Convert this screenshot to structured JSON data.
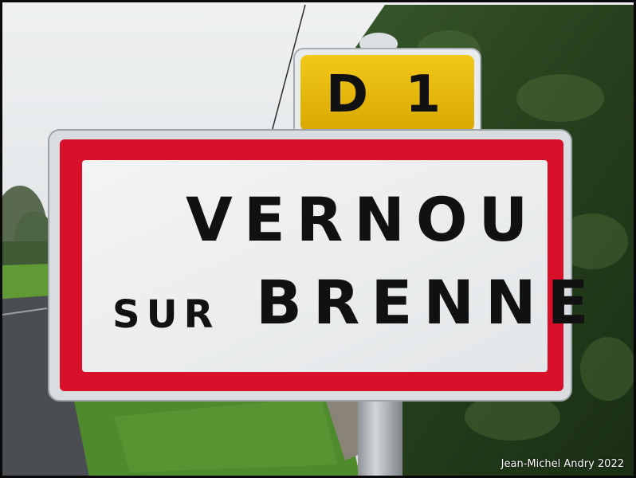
{
  "photo": {
    "subject": "road-sign",
    "colors": {
      "sky": "#e4e8ea",
      "hedge": "#27401f",
      "grass": "#4f8a2c",
      "road": "#4a4d52",
      "sign_border": "#d8102a",
      "sign_face": "#eef0f2",
      "route_plate": "#e8b800"
    }
  },
  "route_plate": {
    "label": "D 1"
  },
  "town_sign": {
    "line1": "VERNOU",
    "line2_small": "SUR",
    "line2_large": "BRENNE"
  },
  "credit": {
    "text": "Jean-Michel Andry 2022"
  }
}
